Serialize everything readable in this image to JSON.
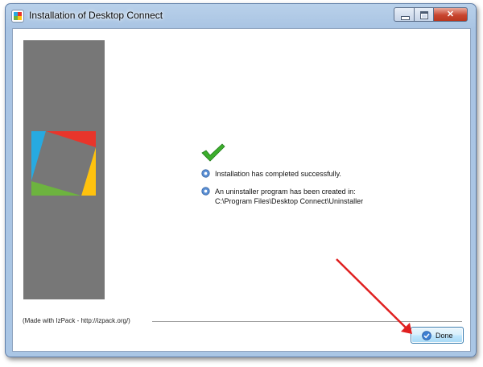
{
  "window": {
    "title": "Installation of Desktop Connect"
  },
  "icons": {
    "app": "installer-app-icon",
    "check": "green-checkmark-icon",
    "bullet": "blue-gear-bullet-icon",
    "done": "blue-checkmark-circle-icon",
    "annotation": "red-arrow"
  },
  "colors": {
    "side_panel": "#777777",
    "logo_red": "#e8352b",
    "logo_yellow": "#ffc20e",
    "logo_green": "#6db33f",
    "logo_blue": "#27aae1",
    "check": "#3cae2c",
    "annotation_arrow": "#e02020"
  },
  "content": {
    "messages": [
      {
        "text": "Installation has completed successfully."
      },
      {
        "text": "An uninstaller program has been created in:",
        "detail": "C:\\Program Files\\Desktop Connect\\Uninstaller"
      }
    ]
  },
  "footer": {
    "made_with": "(Made with IzPack - http://izpack.org/)"
  },
  "buttons": {
    "done_label": "Done"
  }
}
